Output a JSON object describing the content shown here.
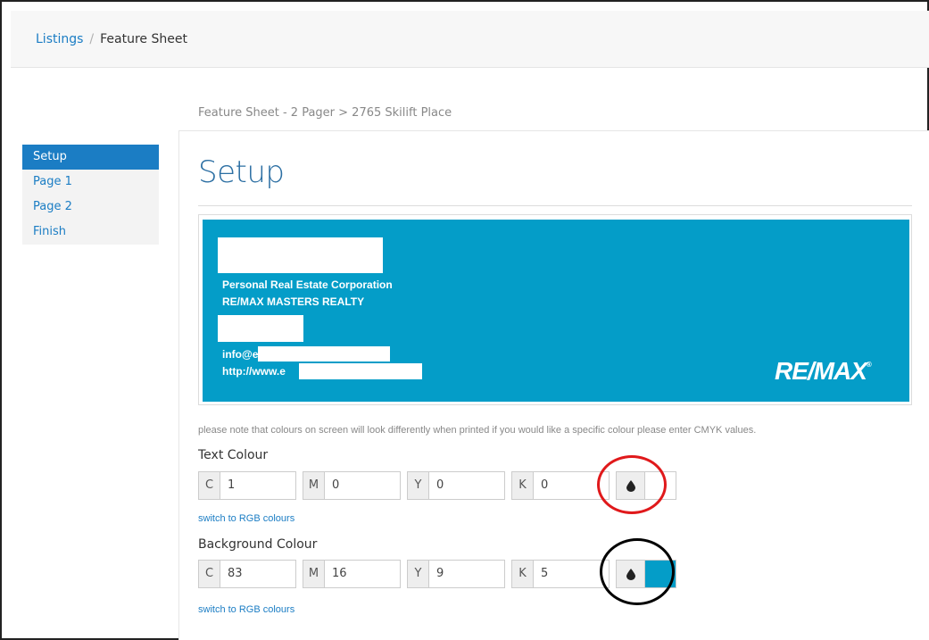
{
  "breadcrumb": {
    "parent": "Listings",
    "separator": "/",
    "current": "Feature Sheet"
  },
  "subcrumb": "Feature Sheet - 2 Pager > 2765 Skilift Place",
  "sidenav": {
    "items": [
      {
        "label": "Setup",
        "active": true
      },
      {
        "label": "Page 1",
        "active": false
      },
      {
        "label": "Page 2",
        "active": false
      },
      {
        "label": "Finish",
        "active": false
      }
    ]
  },
  "title": "Setup",
  "preview": {
    "background_color": "#049dc8",
    "line1": "Personal Real Estate Corporation",
    "line2": "RE/MAX MASTERS REALTY",
    "email_prefix": "info@e",
    "url_prefix": "http://www.e",
    "logo_text": "RE/MAX",
    "logo_mark": "®"
  },
  "note": "please note that colours on screen will look differently when printed if you would like a specific colour please enter CMYK values.",
  "text_colour": {
    "label": "Text Colour",
    "fields": [
      {
        "key": "C",
        "value": "1"
      },
      {
        "key": "M",
        "value": "0"
      },
      {
        "key": "Y",
        "value": "0"
      },
      {
        "key": "K",
        "value": "0"
      }
    ],
    "picker_icon": "droplet-icon",
    "swatch_color": "#ffffff",
    "switch_label": "switch to RGB colours"
  },
  "background_colour": {
    "label": "Background Colour",
    "fields": [
      {
        "key": "C",
        "value": "83"
      },
      {
        "key": "M",
        "value": "16"
      },
      {
        "key": "Y",
        "value": "9"
      },
      {
        "key": "K",
        "value": "5"
      }
    ],
    "picker_icon": "droplet-icon",
    "swatch_color": "#049dc8",
    "switch_label": "switch to RGB colours"
  },
  "colors": {
    "accent": "#1b7dc4",
    "annotation_red": "#e0191b",
    "annotation_black": "#000000"
  }
}
